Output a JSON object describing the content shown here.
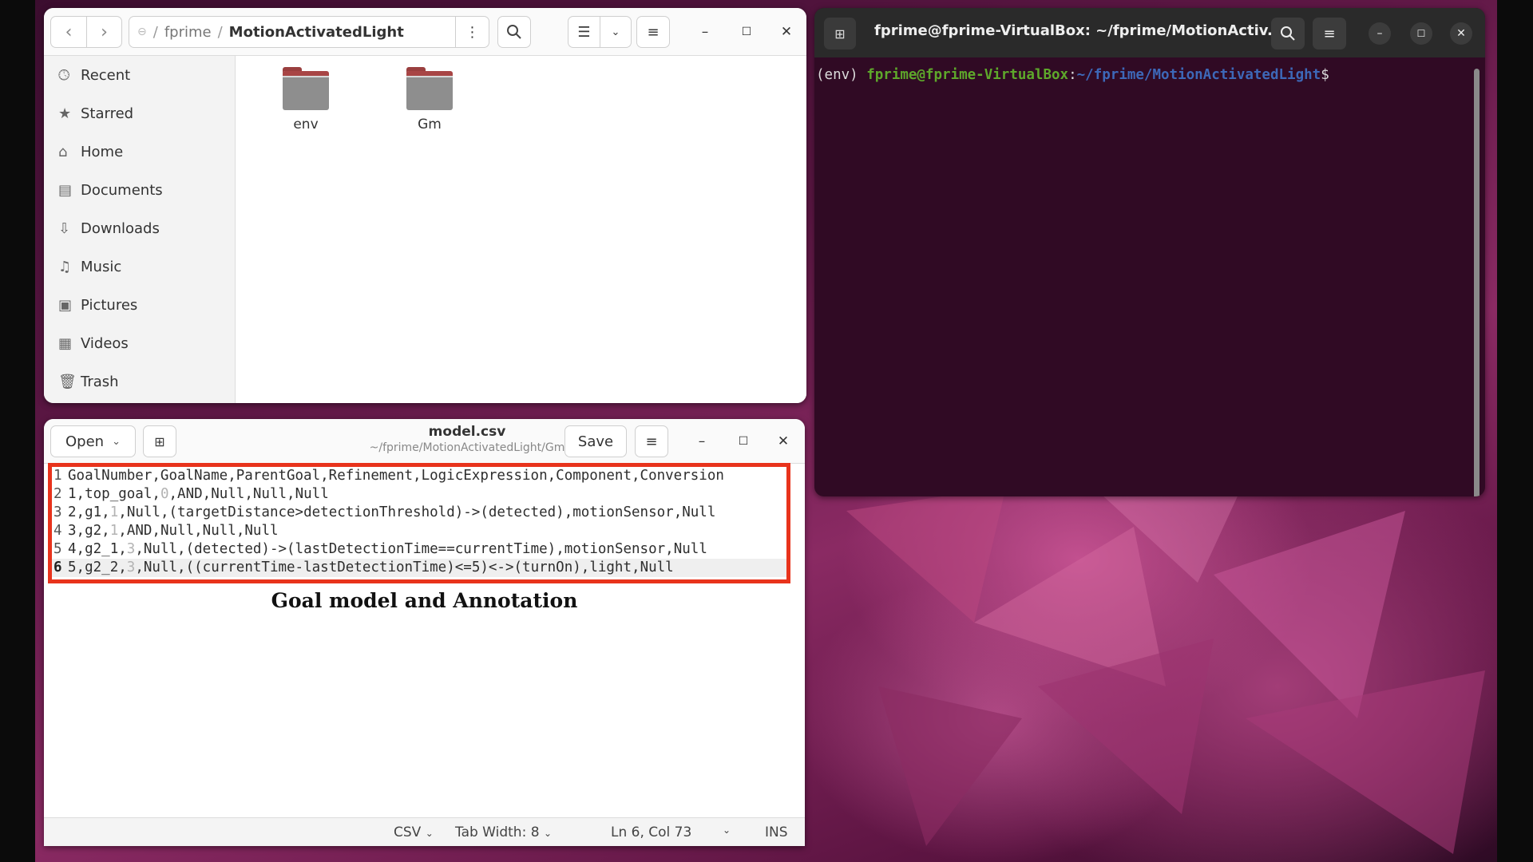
{
  "file_manager": {
    "path": {
      "root_icon": "disk-icon",
      "segments": [
        "fprime",
        "MotionActivatedLight"
      ],
      "separator": "/"
    },
    "sidebar": {
      "items": [
        {
          "label": "Recent",
          "icon": "clock-icon"
        },
        {
          "label": "Starred",
          "icon": "star-icon"
        },
        {
          "label": "Home",
          "icon": "home-icon"
        },
        {
          "label": "Documents",
          "icon": "document-icon"
        },
        {
          "label": "Downloads",
          "icon": "download-icon"
        },
        {
          "label": "Music",
          "icon": "music-icon"
        },
        {
          "label": "Pictures",
          "icon": "picture-icon"
        },
        {
          "label": "Videos",
          "icon": "video-icon"
        },
        {
          "label": "Trash",
          "icon": "trash-icon"
        }
      ]
    },
    "folders": [
      "env",
      "Gm"
    ]
  },
  "editor": {
    "open_label": "Open",
    "title": "model.csv",
    "subtitle": "~/fprime/MotionActivatedLight/Gm",
    "save_label": "Save",
    "lines": [
      {
        "n": "1",
        "text": "GoalNumber,GoalName,ParentGoal,Refinement,LogicExpression,Component,Conversion"
      },
      {
        "n": "2",
        "text": "1,top_goal,0,AND,Null,Null,Null"
      },
      {
        "n": "3",
        "text": "2,g1,1,Null,(targetDistance>detectionThreshold)->(detected),motionSensor,Null"
      },
      {
        "n": "4",
        "text": "3,g2,1,AND,Null,Null,Null"
      },
      {
        "n": "5",
        "text": "4,g2_1,3,Null,(detected)->(lastDetectionTime==currentTime),motionSensor,Null"
      },
      {
        "n": "6",
        "text": "5,g2_2,3,Null,((currentTime-lastDetectionTime)<=5)<->(turnOn),light,Null"
      }
    ],
    "caption": "Goal model and Annotation",
    "status": {
      "language": "CSV",
      "tab_width": "Tab Width: 8",
      "position": "Ln 6, Col 73",
      "mode": "INS"
    }
  },
  "terminal": {
    "title": "fprime@fprime-VirtualBox: ~/fprime/MotionActiv...",
    "prompt_env": "(env) ",
    "prompt_user": "fprime@fprime-VirtualBox",
    "prompt_colon": ":",
    "prompt_path": "~/fprime/MotionActivatedLight",
    "prompt_symbol": "$"
  },
  "colors": {
    "highlight_border": "#e8331c",
    "terminal_bg": "#300a24",
    "prompt_user": "#5ea82b",
    "prompt_path": "#3d68b8"
  }
}
